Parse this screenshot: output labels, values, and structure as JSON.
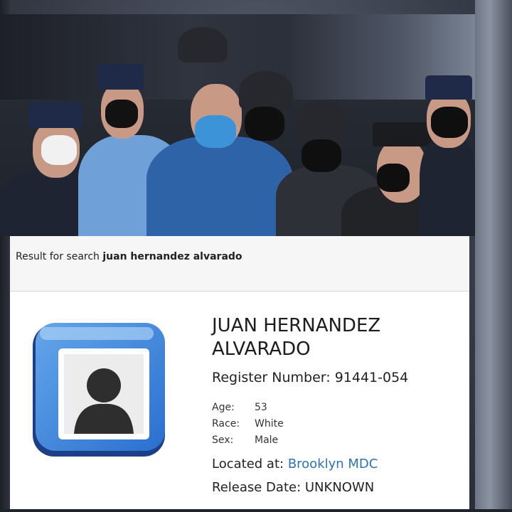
{
  "search": {
    "prefix": "Result for search ",
    "query": "juan hernandez alvarado"
  },
  "inmate": {
    "name_line1": "JUAN HERNANDEZ",
    "name_line2": "ALVARADO",
    "register_label": "Register Number: ",
    "register_number": "91441-054",
    "age_label": "Age:",
    "age": "53",
    "race_label": "Race:",
    "race": "White",
    "sex_label": "Sex:",
    "sex": "Male",
    "located_label": "Located at: ",
    "location": "Brooklyn MDC",
    "release_label": "Release Date: ",
    "release_date": "UNKNOWN"
  },
  "colors": {
    "link": "#2b73b6",
    "avatar_frame": "#2a6fcf",
    "avatar_frame_light": "#64a6ea"
  },
  "icons": {
    "avatar": "person-silhouette-icon"
  }
}
